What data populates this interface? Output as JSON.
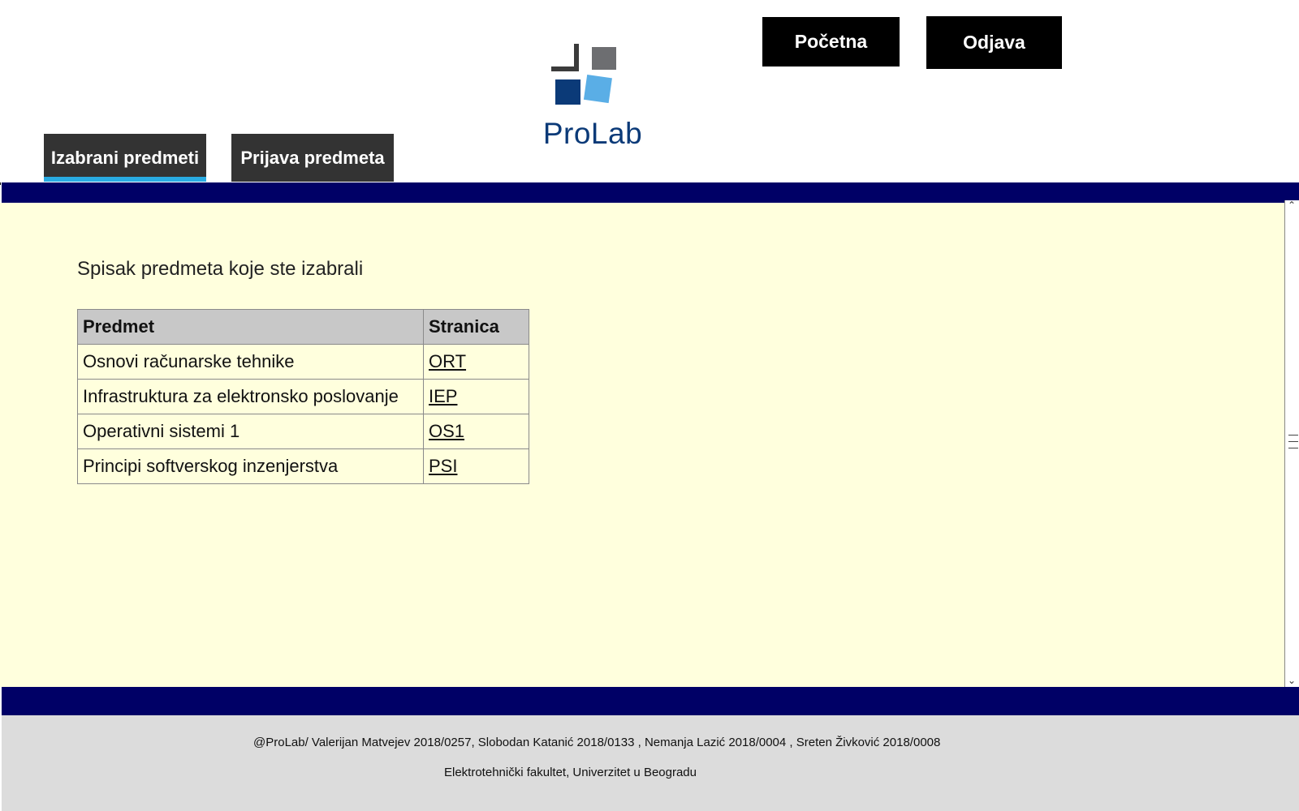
{
  "header": {
    "logo_text": "ProLab",
    "buttons": {
      "home_label": "Početna",
      "logout_label": "Odjava"
    },
    "tabs": [
      {
        "label": "Izabrani predmeti",
        "active": true
      },
      {
        "label": "Prijava predmeta",
        "active": false
      }
    ]
  },
  "main": {
    "heading": "Spisak predmeta koje ste izabrali",
    "table": {
      "columns": [
        "Predmet",
        "Stranica"
      ],
      "rows": [
        {
          "subject": "Osnovi računarske tehnike",
          "page": "ORT"
        },
        {
          "subject": "Infrastruktura za elektronsko poslovanje",
          "page": "IEP"
        },
        {
          "subject": "Operativni sistemi 1",
          "page": "OS1"
        },
        {
          "subject": "Principi softverskog inzenjerstva",
          "page": "PSI"
        }
      ]
    }
  },
  "footer": {
    "credits": "@ProLab/ Valerijan Matvejev 2018/0257, Slobodan Katanić 2018/0133 , Nemanja Lazić 2018/0004 , Sreten Živković 2018/0008",
    "institution": "Elektrotehnički fakultet, Univerzitet u Beogradu"
  },
  "colors": {
    "navy_band": "#000066",
    "content_bg": "#ffffdd",
    "tab_bg": "#333333",
    "tab_active_underline": "#29abe2",
    "footer_bg": "#dcdcdc",
    "logo_text": "#0b3a78"
  },
  "icons": {
    "logo": "prolab-logo-squares",
    "scroll_up": "chevron-up-icon",
    "scroll_down": "chevron-down-icon"
  }
}
